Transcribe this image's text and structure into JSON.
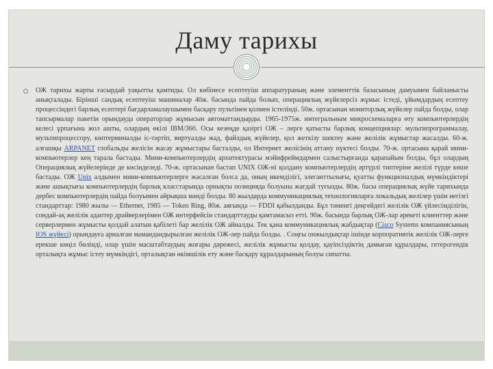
{
  "slide": {
    "title": "Даму тарихы",
    "paragraph_parts": [
      "ОЖ тарихы жарты ғасырдай уақытты қамтиды. Ол көбінесе есептеуіш аппаратураның және элементтік базасының дамуымен байланысты анықталады. Бірінші сандық есептеуіш машиналар 40ж. басында пайда болып, операциялық жүйелерсіз жұмыс істеді, ұйымдардың есептеу процесcіндегі барлық есептері бағдарламалаушымен басқару пультінен қолмен істелінді. 50ж. ортасынан мониторлық жүйелер пайда болды, олар тапсырмалар пакетін орындауда операторлар жұмысын автоматтандырды. 1965-1975ж. интегральным микросхемаларға өту компьютерлердің келесі ұрпағына жол ашты, олардың өкілі IBM/360. Осы кезеңде қазіргі ОЖ – лерге қатысты барлық концепциялар: мультипрограммалау, мультипроцессоpy, көптерминалды іс-тәртіп, виртуалды жад, файлдық жүйелер, қол жеткізу шектеу және желілік жұмыстар жасалды. 60-ж. алғашқы ",
      "ARPANET",
      " глобальды желісін жасау жұмыстары басталды, ол Интернет желісінің аттану нүктесі болды. 70-ж. ортасына қарай мини-компьютерлер кең тарала бастады. Мини-компьютерлердің архитектурасы мэйнфреймдармен салыстырғанда қарапайым болды, бұл олардың Операциялық жүйелерінде де көсінделеді. 70-ж. ортасынан бастап UNIX ОЖ-ні қолдану компьютерлердің әртүрлі типтеріне желілі түрде көше бастады. ОЖ ",
      "Unix",
      " алдымен мини-компьютерлерге жасалған болса да, оның икемділігі, элеганттылығы, қуатты функционалдық мүмкіндіктері және ашықтығы компьютерлердің барлық класстарында орнықты позицияда болуына жағдай туғызды. 80ж. басы операциялық жүйе тарихында дербес компьютерлердің пайда болуымен айрықша мәнді болды. 80 жылдарда коммуникациялық технологияларға локальдық желілер үшін негізгі стандарттар: 1980 жылы — Ethernet, 1985 — Token Ring, 80ж. аяғында — FDDI қабылданды. Бұл тәменгі деңгейдегі желілік ОЖ үйлесімділігін, сондай-ақ желілік адаптер драйверлерімен ОЖ интерфейсін стандарттауды қамтамасыз етті. 90ж. басында барлық ОЖ-лар әрекеті клиенттер және серверлермен жұмысты қолдай алатын қабілеті бар желілік ОЖ айналды. Тек қана коммуникациялық жабдықтар (",
      "Cisco",
      " Systems компаниясының ",
      "IOS жүйесі",
      ") орындауға арналған мамандандырылған желілік ОЖ-лер пайда болды. . Соңғы онжылдықтар ішінде корпоративтік желілік ОЖ-лерге ерекше көңіл бөлінді, олар үшін масштабтаудың жоғары дәрежесі, желілік жұмысты қолдау, қауіпсіздіктің дамыған құралдары, гетерогендік орталықта жұмыс істеу мүмкіндігі, орталықтан өкімшілік ету және басқару құралдарының болуы сипатты."
    ]
  }
}
